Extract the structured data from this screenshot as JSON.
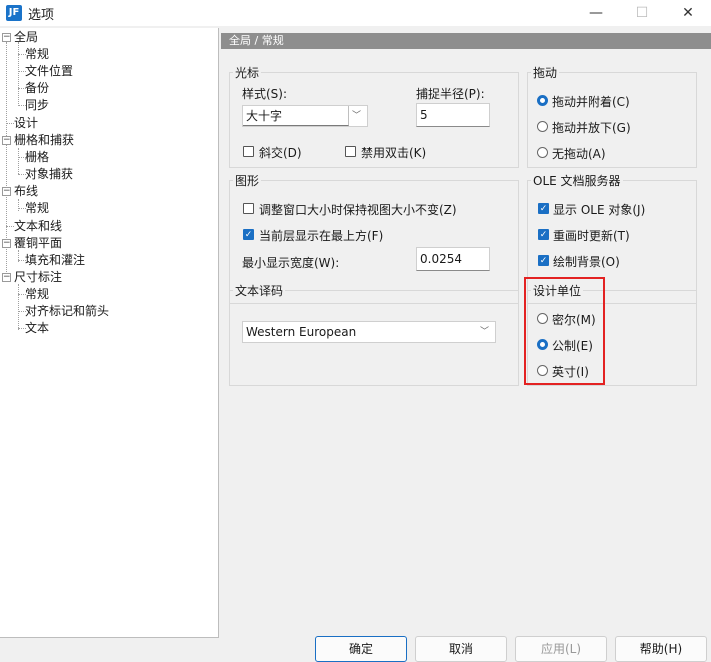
{
  "window": {
    "title": "选项",
    "app_icon_text": "JF"
  },
  "tree": [
    {
      "label": "全局",
      "level": 0,
      "expanded": true
    },
    {
      "label": "常规",
      "level": 1
    },
    {
      "label": "文件位置",
      "level": 1
    },
    {
      "label": "备份",
      "level": 1
    },
    {
      "label": "同步",
      "level": 1
    },
    {
      "label": "设计",
      "level": 0
    },
    {
      "label": "栅格和捕获",
      "level": 0,
      "expanded": true
    },
    {
      "label": "栅格",
      "level": 1
    },
    {
      "label": "对象捕获",
      "level": 1
    },
    {
      "label": "布线",
      "level": 0,
      "expanded": true
    },
    {
      "label": "常规",
      "level": 1
    },
    {
      "label": "文本和线",
      "level": 0
    },
    {
      "label": "覆铜平面",
      "level": 0,
      "expanded": true
    },
    {
      "label": "填充和灌注",
      "level": 1
    },
    {
      "label": "尺寸标注",
      "level": 0,
      "expanded": true
    },
    {
      "label": "常规",
      "level": 1
    },
    {
      "label": "对齐标记和箭头",
      "level": 1
    },
    {
      "label": "文本",
      "level": 1
    }
  ],
  "pane": {
    "header": "全局 / 常规"
  },
  "cursor": {
    "title": "光标",
    "style_label": "样式(S):",
    "style_value": "大十字",
    "snap_radius_label": "捕捉半径(P):",
    "snap_radius_value": "5",
    "orthogonal_label": "斜交(D)",
    "orthogonal_checked": false,
    "disable_dblclick_label": "禁用双击(K)",
    "disable_dblclick_checked": false
  },
  "drag": {
    "title": "拖动",
    "options": [
      {
        "label": "拖动并附着(C)",
        "selected": true
      },
      {
        "label": "拖动并放下(G)",
        "selected": false
      },
      {
        "label": "无拖动(A)",
        "selected": false
      }
    ]
  },
  "graphics": {
    "title": "图形",
    "keep_size_label": "调整窗口大小时保持视图大小不变(Z)",
    "keep_size_checked": false,
    "current_layer_top_label": "当前层显示在最上方(F)",
    "current_layer_top_checked": true,
    "min_width_label": "最小显示宽度(W):",
    "min_width_value": "0.0254"
  },
  "ole": {
    "title": "OLE 文档服务器",
    "options": [
      {
        "label": "显示 OLE 对象(J)",
        "checked": true
      },
      {
        "label": "重画时更新(T)",
        "checked": true
      },
      {
        "label": "绘制背景(O)",
        "checked": true
      }
    ]
  },
  "encoding": {
    "title": "文本译码",
    "value": "Western European"
  },
  "units": {
    "title": "设计单位",
    "options": [
      {
        "label": "密尔(M)",
        "selected": false
      },
      {
        "label": "公制(E)",
        "selected": true
      },
      {
        "label": "英寸(I)",
        "selected": false
      }
    ]
  },
  "buttons": {
    "ok": "确定",
    "cancel": "取消",
    "apply": "应用(L)",
    "help": "帮助(H)"
  }
}
